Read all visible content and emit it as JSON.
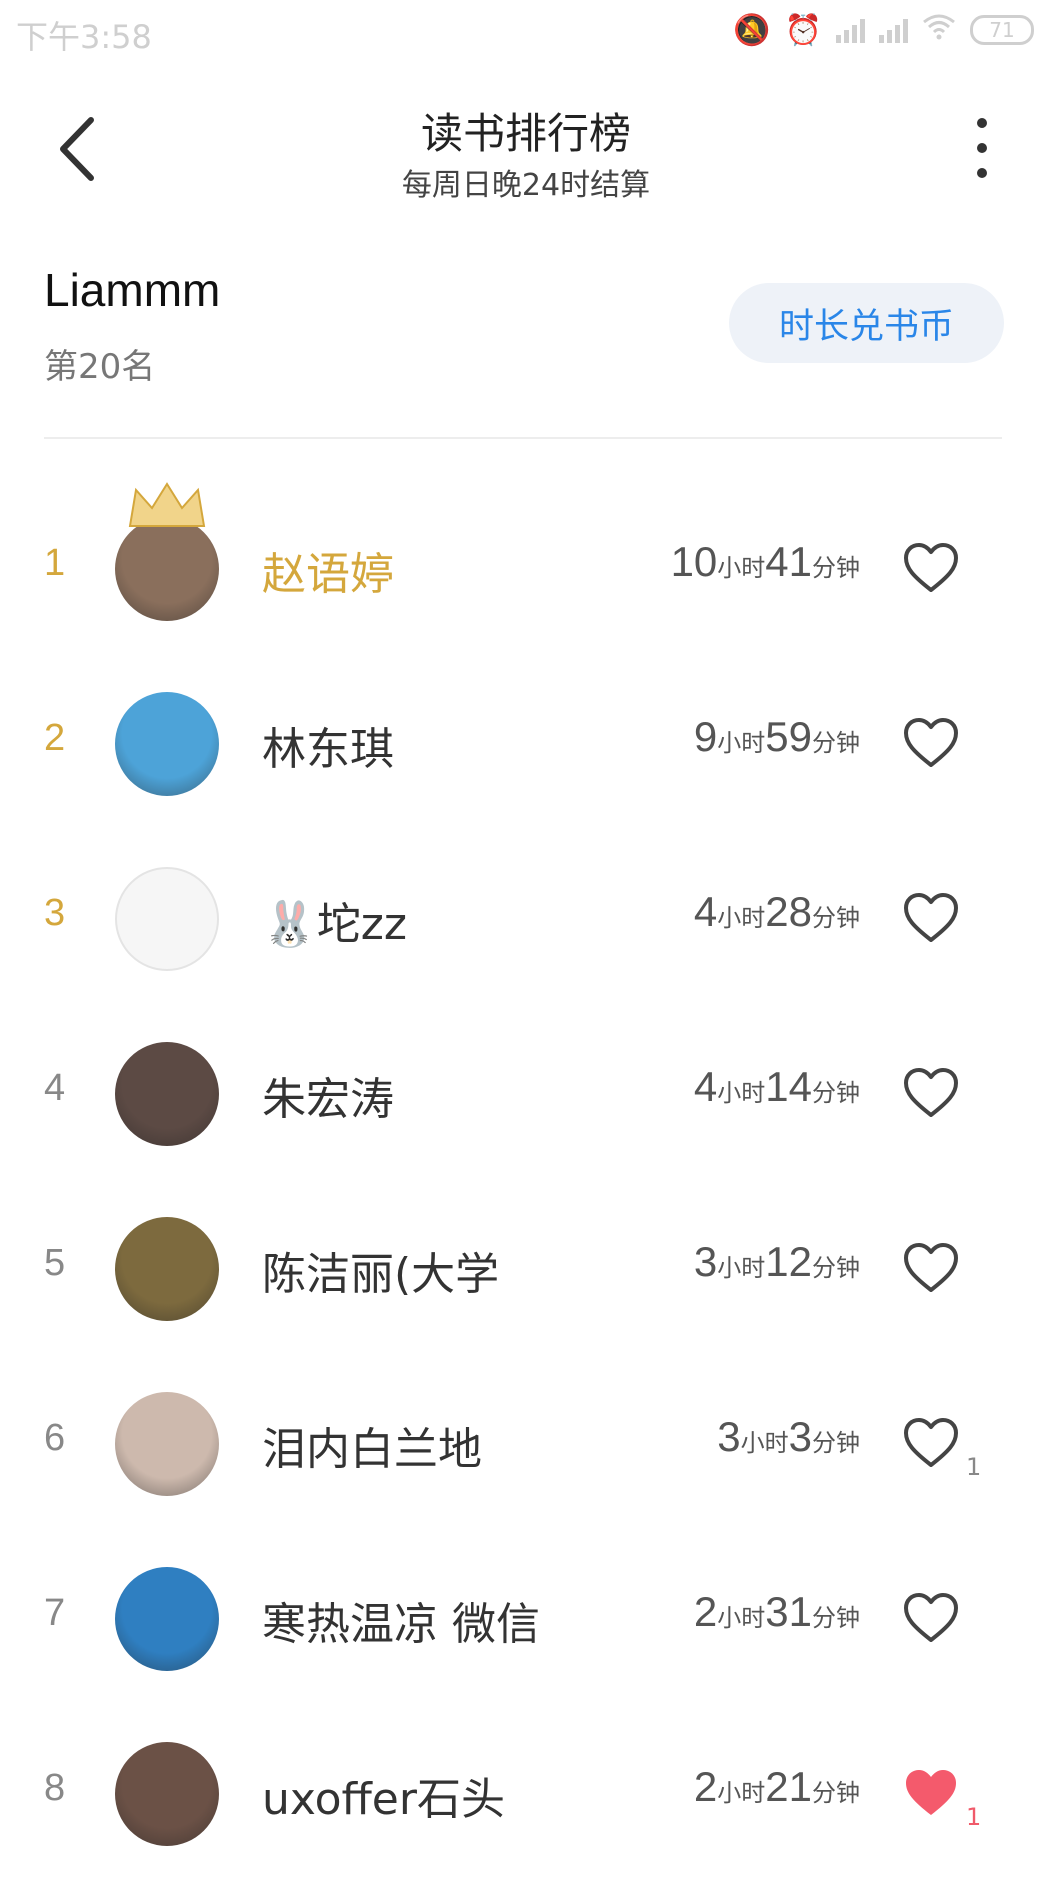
{
  "status_bar": {
    "time": "下午3:58",
    "battery": "71"
  },
  "header": {
    "title": "读书排行榜",
    "subtitle": "每周日晚24时结算"
  },
  "me": {
    "name": "Liammm",
    "rank": "第20名",
    "exchange_button": "时长兑书币"
  },
  "ranking": [
    {
      "rank": "1",
      "name": "赵语婷",
      "hours": "10",
      "minutes": "41",
      "likes": "",
      "liked": false,
      "avatar_color": "#8a6f5c"
    },
    {
      "rank": "2",
      "name": "林东琪",
      "hours": "9",
      "minutes": "59",
      "likes": "",
      "liked": false,
      "avatar_color": "#4da3d8"
    },
    {
      "rank": "3",
      "name": "🐰坨zz",
      "hours": "4",
      "minutes": "28",
      "likes": "",
      "liked": false,
      "avatar_color": "#f3f3f3"
    },
    {
      "rank": "4",
      "name": "朱宏涛",
      "hours": "4",
      "minutes": "14",
      "likes": "",
      "liked": false,
      "avatar_color": "#5c4a44"
    },
    {
      "rank": "5",
      "name": "陈洁丽(大学",
      "hours": "3",
      "minutes": "12",
      "likes": "",
      "liked": false,
      "avatar_color": "#7d6a3e"
    },
    {
      "rank": "6",
      "name": "泪内白兰地",
      "hours": "3",
      "minutes": "3",
      "likes": "1",
      "liked": false,
      "avatar_color": "#cdb9ad"
    },
    {
      "rank": "7",
      "name": "寒热温凉 微信",
      "hours": "2",
      "minutes": "31",
      "likes": "",
      "liked": false,
      "avatar_color": "#2f7fc1"
    },
    {
      "rank": "8",
      "name": "uxoffer石头",
      "hours": "2",
      "minutes": "21",
      "likes": "1",
      "liked": true,
      "avatar_color": "#6b5146"
    }
  ],
  "units": {
    "hour": "小时",
    "minute": "分钟"
  },
  "colors": {
    "gold": "#d4a73c",
    "accent_blue": "#2a86e8",
    "heart_red": "#f45a6c"
  },
  "icons": {
    "back": "chevron-left-icon",
    "more": "more-vertical-icon",
    "heart": "heart-icon",
    "crown": "crown-icon"
  }
}
